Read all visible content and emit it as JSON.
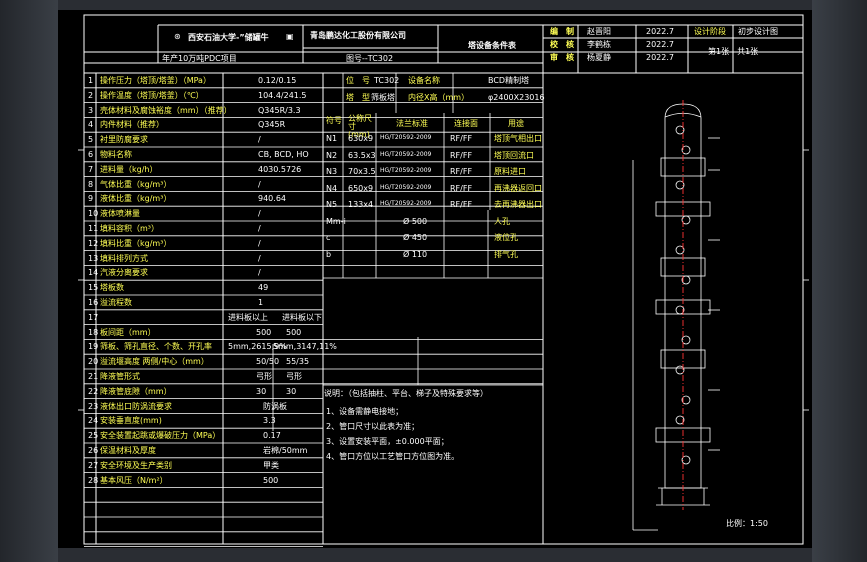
{
  "header": {
    "university": "西安石油大学-”储罐牛",
    "company": "青岛鹏达化工股份有限公司",
    "project": "年产10万吨PDC项目",
    "drawing_title": "塔设备条件表",
    "drawing_no": "图号--TC302"
  },
  "signoff": [
    {
      "role": "编　制",
      "name": "赵晋阳",
      "date": "2022.7",
      "extra_label": "设计阶段",
      "extra_value": "初步设计图"
    },
    {
      "role": "校　核",
      "name": "李鹤栋",
      "date": "2022.7"
    },
    {
      "role": "审　核",
      "name": "杨夏静",
      "date": "2022.7",
      "sheet_info": "第1张　共1张"
    }
  ],
  "params": [
    {
      "no": "1",
      "label": "操作压力（塔顶/塔釜）（MPa）",
      "value": "0.12/0.15"
    },
    {
      "no": "2",
      "label": "操作温度（塔顶/塔釜）（℃）",
      "value": "104.4/241.5"
    },
    {
      "no": "3",
      "label": "壳体材料及腐蚀裕度（mm）（推荐）",
      "value": "Q345R/3.3"
    },
    {
      "no": "4",
      "label": "内件材料（推荐）",
      "value": "Q345R"
    },
    {
      "no": "5",
      "label": "衬里防腐要求",
      "value": "/"
    },
    {
      "no": "6",
      "label": "物料名称",
      "value": "CB, BCD, HO"
    },
    {
      "no": "7",
      "label": "进料量（kg/h）",
      "value": "4030.5726"
    },
    {
      "no": "8",
      "label": "气体比重（kg/m³）",
      "value": "/"
    },
    {
      "no": "9",
      "label": "液体比重（kg/m³）",
      "value": "940.64"
    },
    {
      "no": "10",
      "label": "液体喷淋量",
      "value": "/"
    },
    {
      "no": "11",
      "label": "填料容积（m³）",
      "value": "/"
    },
    {
      "no": "12",
      "label": "填料比重（kg/m³）",
      "value": "/"
    },
    {
      "no": "13",
      "label": "填料排列方式",
      "value": "/"
    },
    {
      "no": "14",
      "label": "汽液分离要求",
      "value": "/"
    },
    {
      "no": "15",
      "label": "塔板数",
      "value": "49"
    },
    {
      "no": "16",
      "label": "溢流程数",
      "value": "1"
    }
  ],
  "row17": {
    "no": "17",
    "above_label": "进料板以上",
    "below_label": "进料板以下"
  },
  "row18": {
    "no": "18",
    "label": "板间距（mm）",
    "above": "500",
    "below": "500"
  },
  "row19": {
    "no": "19",
    "label": "筛板、筛孔直径、个数、开孔率",
    "above": "5mm,2615,9%",
    "below": "5mm,3147,11%"
  },
  "row20": {
    "no": "20",
    "label": "溢流堰高度 两侧/中心（mm）",
    "above": "50/50",
    "below": "55/35"
  },
  "row21": {
    "no": "21",
    "label": "降液管形式",
    "above": "弓形",
    "below": "弓形"
  },
  "row22": {
    "no": "22",
    "label": "降液管底隙（mm）",
    "above": "30",
    "below": "30"
  },
  "row23": {
    "no": "23",
    "label": "液体出口防涡流要求",
    "value": "防涡板"
  },
  "row24": {
    "no": "24",
    "label": "安装垂直度(mm)",
    "value": "3.3"
  },
  "row25": {
    "no": "25",
    "label": "安全装置起跳或爆破压力（MPa）",
    "value": "0.17"
  },
  "row26": {
    "no": "26",
    "label": "保温材料及厚度",
    "value": "岩棉/50mm"
  },
  "row27": {
    "no": "27",
    "label": "安全环境及生产类别",
    "value": "甲类"
  },
  "row28": {
    "no": "28",
    "label": "基本风压（N/m²）",
    "value": "500"
  },
  "equipment": {
    "tag_label": "位　号",
    "tag": "TC302",
    "name_label": "设备名称",
    "name": "BCD精制塔",
    "type_label": "塔　型",
    "type": "筛板塔",
    "dim_label": "内径X高（mm）",
    "dim": "φ2400X23016"
  },
  "nozzle_headers": {
    "no": "符号",
    "size": "公称尺寸(mm)",
    "std": "法兰标准",
    "face": "连接面",
    "use": "用途"
  },
  "nozzles": [
    {
      "no": "N1",
      "size": "630x9",
      "std": "HG/T20592-2009",
      "face": "RF/FF",
      "use": "塔顶气相出口"
    },
    {
      "no": "N2",
      "size": "63.5x3",
      "std": "HG/T20592-2009",
      "face": "RF/FF",
      "use": "塔顶回流口"
    },
    {
      "no": "N3",
      "size": "70x3.5",
      "std": "HG/T20592-2009",
      "face": "RF/FF",
      "use": "原料进口"
    },
    {
      "no": "N4",
      "size": "650x9",
      "std": "HG/T20592-2009",
      "face": "RF/FF",
      "use": "再沸器返回口"
    },
    {
      "no": "N5",
      "size": "133x4",
      "std": "HG/T20592-2009",
      "face": "RF/FF",
      "use": "去再沸器出口"
    },
    {
      "no": "Mm-i",
      "size": "Ø 500",
      "use": "人孔"
    },
    {
      "no": "c",
      "size": "Ø 450",
      "use": "液位孔"
    },
    {
      "no": "b",
      "size": "Ø 110",
      "use": "排气孔"
    }
  ],
  "notes": {
    "title": "说明：（包括抽柱、平台、梯子及特殊要求等）",
    "items": [
      "1、设备需静电接地；",
      "2、管口尺寸以此表为准；",
      "3、设置安装平面，±0.000平面；",
      "4、管口方位以工艺管口方位图为准。"
    ]
  },
  "scale": "比例：1:50",
  "colors": {
    "text": "#ffffff",
    "label": "#ffff55",
    "accent": "#55ffff",
    "line": "#ffffff",
    "centerline": "#ff3333"
  }
}
